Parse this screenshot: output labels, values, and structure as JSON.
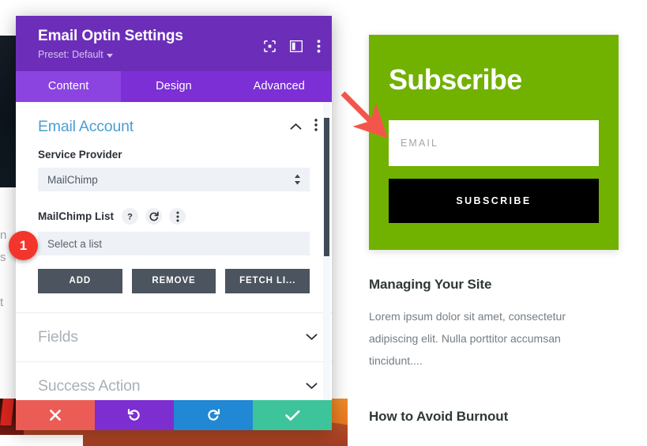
{
  "modal": {
    "title": "Email Optin Settings",
    "preset_label": "Preset: Default",
    "header_icons": [
      {
        "name": "focus-icon"
      },
      {
        "name": "layout-panel-icon"
      },
      {
        "name": "more-vertical-icon"
      }
    ],
    "tabs": [
      {
        "label": "Content",
        "active": true
      },
      {
        "label": "Design",
        "active": false
      },
      {
        "label": "Advanced",
        "active": false
      }
    ],
    "sections": {
      "email_account": {
        "title": "Email Account",
        "expanded": true,
        "service_provider": {
          "label": "Service Provider",
          "value": "MailChimp"
        },
        "mailchimp_list": {
          "label": "MailChimp List",
          "value": "",
          "placeholder": "Select a list",
          "icons": [
            "help-icon",
            "reset-icon",
            "more-vertical-icon"
          ]
        },
        "buttons": [
          {
            "label": "ADD"
          },
          {
            "label": "REMOVE"
          },
          {
            "label": "FETCH LI..."
          }
        ]
      },
      "fields": {
        "title": "Fields",
        "expanded": false
      },
      "success_action": {
        "title": "Success Action",
        "expanded": false
      }
    },
    "footer_buttons": [
      {
        "name": "cancel-button",
        "icon": "close-icon",
        "color": "#ea5c55"
      },
      {
        "name": "undo-button",
        "icon": "undo-icon",
        "color": "#7d2ed1"
      },
      {
        "name": "redo-button",
        "icon": "redo-icon",
        "color": "#2088d4"
      },
      {
        "name": "save-button",
        "icon": "check-icon",
        "color": "#3ec49a"
      }
    ]
  },
  "annotation": {
    "step_number": "1",
    "badge_color": "#f4352c",
    "arrow_color": "#f4554b"
  },
  "preview": {
    "optin": {
      "heading": "Subscribe",
      "email_placeholder": "EMAIL",
      "submit_label": "SUBSCRIBE",
      "background_color": "#71b100",
      "button_color": "#000000"
    },
    "posts": [
      {
        "title": "Managing Your Site",
        "excerpt": "Lorem ipsum dolor sit amet, consectetur adipiscing elit. Nulla porttitor accumsan tincidunt...."
      },
      {
        "title": "How to Avoid Burnout",
        "excerpt": ""
      }
    ]
  },
  "background": {
    "left_text_fragments": [
      "n",
      "s",
      "t"
    ]
  }
}
